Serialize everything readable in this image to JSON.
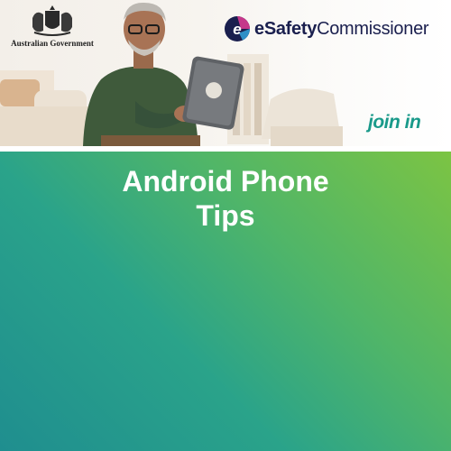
{
  "header": {
    "gov_logo": {
      "icon": "coat-of-arms-icon",
      "text": "Australian Government"
    },
    "esafety_logo": {
      "icon": "esafety-e-icon",
      "brand_e": "eSafety",
      "brand_rest": "Commissioner"
    },
    "tagline": "join in"
  },
  "main": {
    "title_line1": "Android Phone",
    "title_line2": "Tips"
  },
  "colors": {
    "gradient_start": "#7cc443",
    "gradient_end": "#1f8e8f",
    "brand_navy": "#1a1f4e",
    "brand_teal": "#1a9a8a"
  }
}
